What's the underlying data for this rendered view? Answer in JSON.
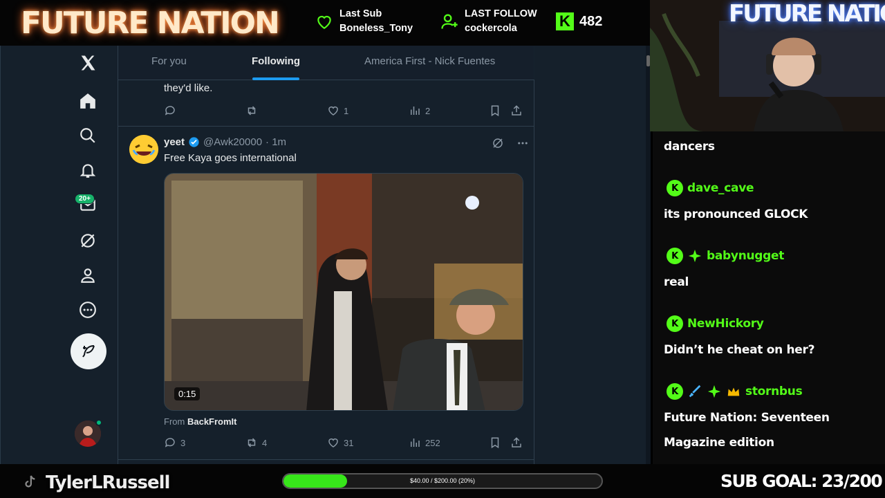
{
  "overlay": {
    "brand": "FUTURE NATION",
    "last_sub": {
      "label": "Last Sub",
      "value": "Boneless_Tony"
    },
    "last_follow": {
      "label": "LAST FOLLOW",
      "value": "cockercola"
    },
    "kick_count": "482",
    "streamer": "TylerLRussell",
    "progress": {
      "label": "$40.00 / $200.00 (20%)",
      "fraction": 0.2
    },
    "sub_goal": "SUB GOAL: 23/200",
    "webcam_sign": "FUTURE NATION"
  },
  "x": {
    "messages_badge": "20+",
    "tabs": [
      "For you",
      "Following",
      "America First - Nick Fuentes"
    ],
    "active_tab": "Following",
    "prev_post": {
      "text_tail": "they'd like.",
      "likes": "1",
      "views": "2"
    },
    "post": {
      "name": "yeet",
      "handle": "@Awk20000",
      "time": "· 1m",
      "text": "Free Kaya goes international",
      "duration": "0:15",
      "from_label": "From",
      "from_source": "BackFromIt",
      "replies": "3",
      "reposts": "4",
      "likes": "31",
      "views": "252"
    }
  },
  "chat": {
    "messages": [
      {
        "text": "dancers"
      },
      {
        "user": "dave_cave",
        "text": "its pronounced GLOCK"
      },
      {
        "user": "babynugget",
        "text": "real"
      },
      {
        "user": "NewHickory",
        "text": "Didn’t he cheat on her?"
      },
      {
        "user": "stornbus",
        "text": "Future Nation: Seventeen"
      },
      {
        "text": "Magazine edition"
      }
    ]
  },
  "colors": {
    "kick_green": "#53fc18",
    "x_bg": "#15202b",
    "x_blue": "#1d9bf0"
  }
}
